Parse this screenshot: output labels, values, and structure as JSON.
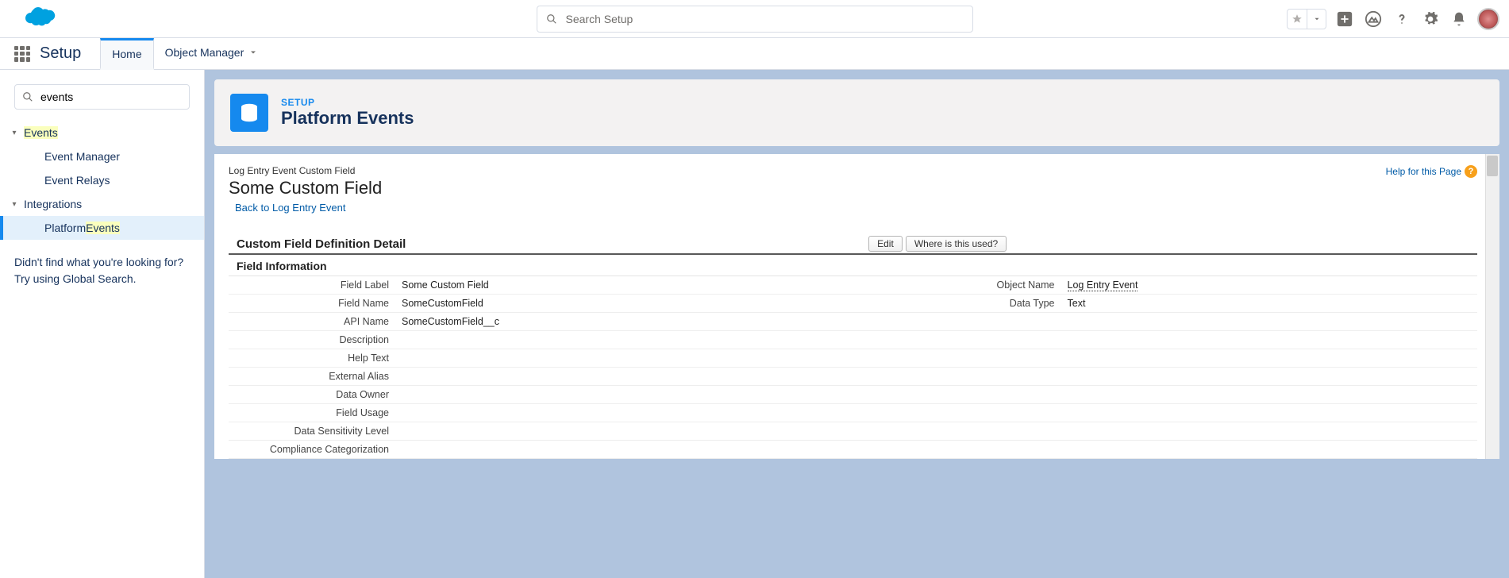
{
  "header": {
    "search_placeholder": "Search Setup"
  },
  "nav": {
    "setup_label": "Setup",
    "tabs": {
      "home": "Home",
      "object_manager": "Object Manager"
    }
  },
  "sidebar": {
    "search_value": "events",
    "groups": {
      "events": {
        "label_pre": "",
        "label_hl": "Events"
      },
      "integrations": {
        "label": "Integrations"
      }
    },
    "items": {
      "event_manager": "Event Manager",
      "event_relays": "Event Relays",
      "platform_events": {
        "pre": "Platform ",
        "hl": "Events"
      }
    },
    "footer_line1": "Didn't find what you're looking for?",
    "footer_line2": "Try using Global Search."
  },
  "page_header": {
    "eyebrow": "SETUP",
    "title": "Platform Events"
  },
  "detail": {
    "breadcrumb": "Log Entry Event Custom Field",
    "record_title": "Some Custom Field",
    "back_link": "Back to Log Entry Event",
    "help_link": "Help for this Page",
    "section_title": "Custom Field Definition Detail",
    "buttons": {
      "edit": "Edit",
      "where_used": "Where is this used?"
    },
    "subsection": "Field Information",
    "fields": {
      "field_label": {
        "label": "Field Label",
        "value": "Some Custom Field"
      },
      "object_name": {
        "label": "Object Name",
        "value": "Log Entry Event"
      },
      "field_name": {
        "label": "Field Name",
        "value": "SomeCustomField"
      },
      "data_type": {
        "label": "Data Type",
        "value": "Text"
      },
      "api_name": {
        "label": "API Name",
        "value": "SomeCustomField__c"
      },
      "description": {
        "label": "Description",
        "value": ""
      },
      "help_text": {
        "label": "Help Text",
        "value": ""
      },
      "external_alias": {
        "label": "External Alias",
        "value": ""
      },
      "data_owner": {
        "label": "Data Owner",
        "value": ""
      },
      "field_usage": {
        "label": "Field Usage",
        "value": ""
      },
      "data_sensitivity": {
        "label": "Data Sensitivity Level",
        "value": ""
      },
      "compliance": {
        "label": "Compliance Categorization",
        "value": ""
      }
    }
  }
}
